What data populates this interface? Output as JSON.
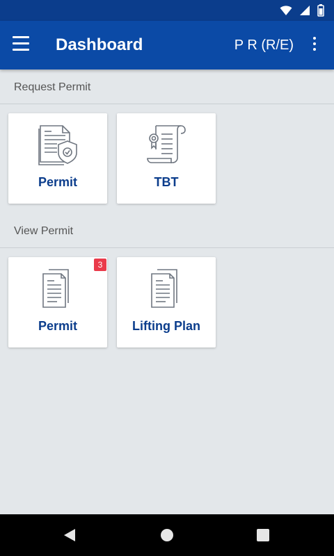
{
  "app_bar": {
    "title": "Dashboard",
    "user": "P R (R/E)",
    "menu_icon": "hamburger-menu-icon",
    "more_icon": "more-vertical-icon",
    "color": "#0b4aa6"
  },
  "status_bar": {
    "icons": [
      "wifi-icon",
      "signal-icon",
      "battery-icon"
    ],
    "color": "#0b3d8c"
  },
  "sections": [
    {
      "title": "Request Permit",
      "tiles": [
        {
          "label": "Permit",
          "icon": "document-shield-icon"
        },
        {
          "label": "TBT",
          "icon": "certificate-scroll-icon"
        }
      ]
    },
    {
      "title": "View Permit",
      "tiles": [
        {
          "label": "Permit",
          "icon": "documents-icon",
          "badge": "3"
        },
        {
          "label": "Lifting Plan",
          "icon": "documents-icon"
        }
      ]
    }
  ],
  "nav_bar": {
    "icons": [
      "back-icon",
      "home-icon",
      "recents-icon"
    ]
  },
  "colors": {
    "accent": "#0b3d8c",
    "badge": "#ea3a4a",
    "background": "#e3e7ea"
  }
}
